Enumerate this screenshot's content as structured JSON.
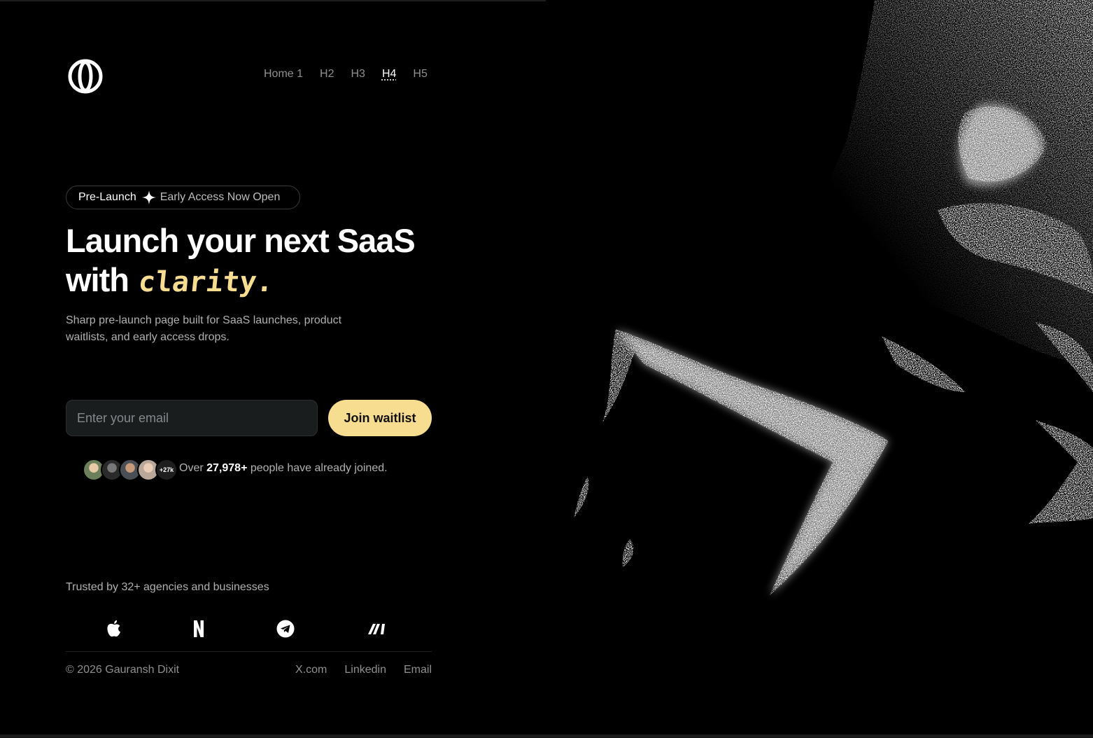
{
  "nav": {
    "items": [
      {
        "label": "Home 1"
      },
      {
        "label": "H2"
      },
      {
        "label": "H3"
      },
      {
        "label": "H4",
        "active": true
      },
      {
        "label": "H5"
      }
    ]
  },
  "badge": {
    "primary": "Pre-Launch",
    "secondary": "Early Access Now Open",
    "icon": "sparkle-icon"
  },
  "hero": {
    "headline_line1": "Launch your next SaaS",
    "headline_line2": "with",
    "headline_accent": "clarity.",
    "subtitle": "Sharp pre-launch page built for SaaS launches, product waitlists, and early access drops."
  },
  "form": {
    "email_placeholder": "Enter your email",
    "email_value": "",
    "submit_label": "Join waitlist"
  },
  "social_proof": {
    "avatar_count_label": "+27k",
    "prefix": "Over",
    "count": "27,978+",
    "suffix": "people have already joined."
  },
  "trusted": {
    "label": "Trusted by 32+ agencies and businesses",
    "brands": [
      "apple-icon",
      "netflix-icon",
      "telegram-icon",
      "make-icon"
    ]
  },
  "footer": {
    "copyright": "© 2026 Gauransh Dixit",
    "links": [
      "X.com",
      "Linkedin",
      "Email"
    ]
  },
  "colors": {
    "background": "#000000",
    "accent": "#f7dd8f",
    "muted_text": "#8f8f8f",
    "input_bg": "#1a1d1e"
  }
}
